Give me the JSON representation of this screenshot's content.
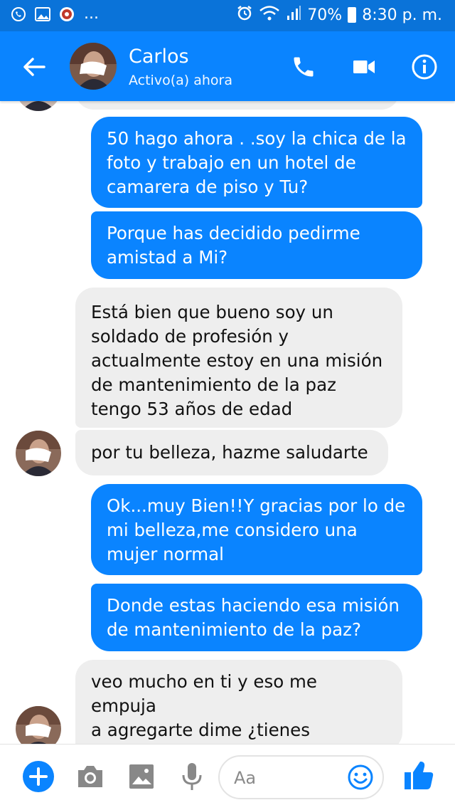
{
  "status_bar": {
    "battery": "70%",
    "time": "8:30 p. m.",
    "more": "..."
  },
  "header": {
    "contact_name": "Carlos",
    "status": "Activo(a) ahora"
  },
  "messages": [
    {
      "from": "me",
      "text": "50 hago ahora . .soy la chica de la\nfoto y trabajo en un hotel de\ncamarera de piso y Tu?"
    },
    {
      "from": "me",
      "text": "Porque has decidido pedirme\namistad a Mi?"
    },
    {
      "from": "them",
      "text": "Está bien que bueno soy un\nsoldado de profesión y\nactualmente estoy en una misión\nde mantenimiento de la paz\ntengo 53 años de edad"
    },
    {
      "from": "them",
      "text": "por tu belleza, hazme saludarte"
    },
    {
      "from": "me",
      "text": "Ok...muy Bien!!Y gracias por lo de\nmi belleza,me considero una\nmujer normal"
    },
    {
      "from": "me",
      "text": "Donde estas haciendo esa misión\nde mantenimiento de la paz?"
    },
    {
      "from": "them",
      "text": "veo mucho en ti y eso me empuja\na agregarte dime ¿tienes\npasatiempo?"
    }
  ],
  "composer": {
    "placeholder": "Aa"
  },
  "colors": {
    "accent": "#0a84ff",
    "status_bar": "#0a73d9",
    "incoming_bubble": "#eeeeee"
  },
  "icons": [
    "whatsapp-icon",
    "gallery-icon",
    "app-icon",
    "alarm-icon",
    "wifi-icon",
    "signal-icon",
    "battery-icon",
    "back-arrow-icon",
    "phone-icon",
    "video-icon",
    "info-icon",
    "plus-icon",
    "camera-icon",
    "image-icon",
    "microphone-icon",
    "emoji-icon",
    "thumbs-up-icon"
  ]
}
